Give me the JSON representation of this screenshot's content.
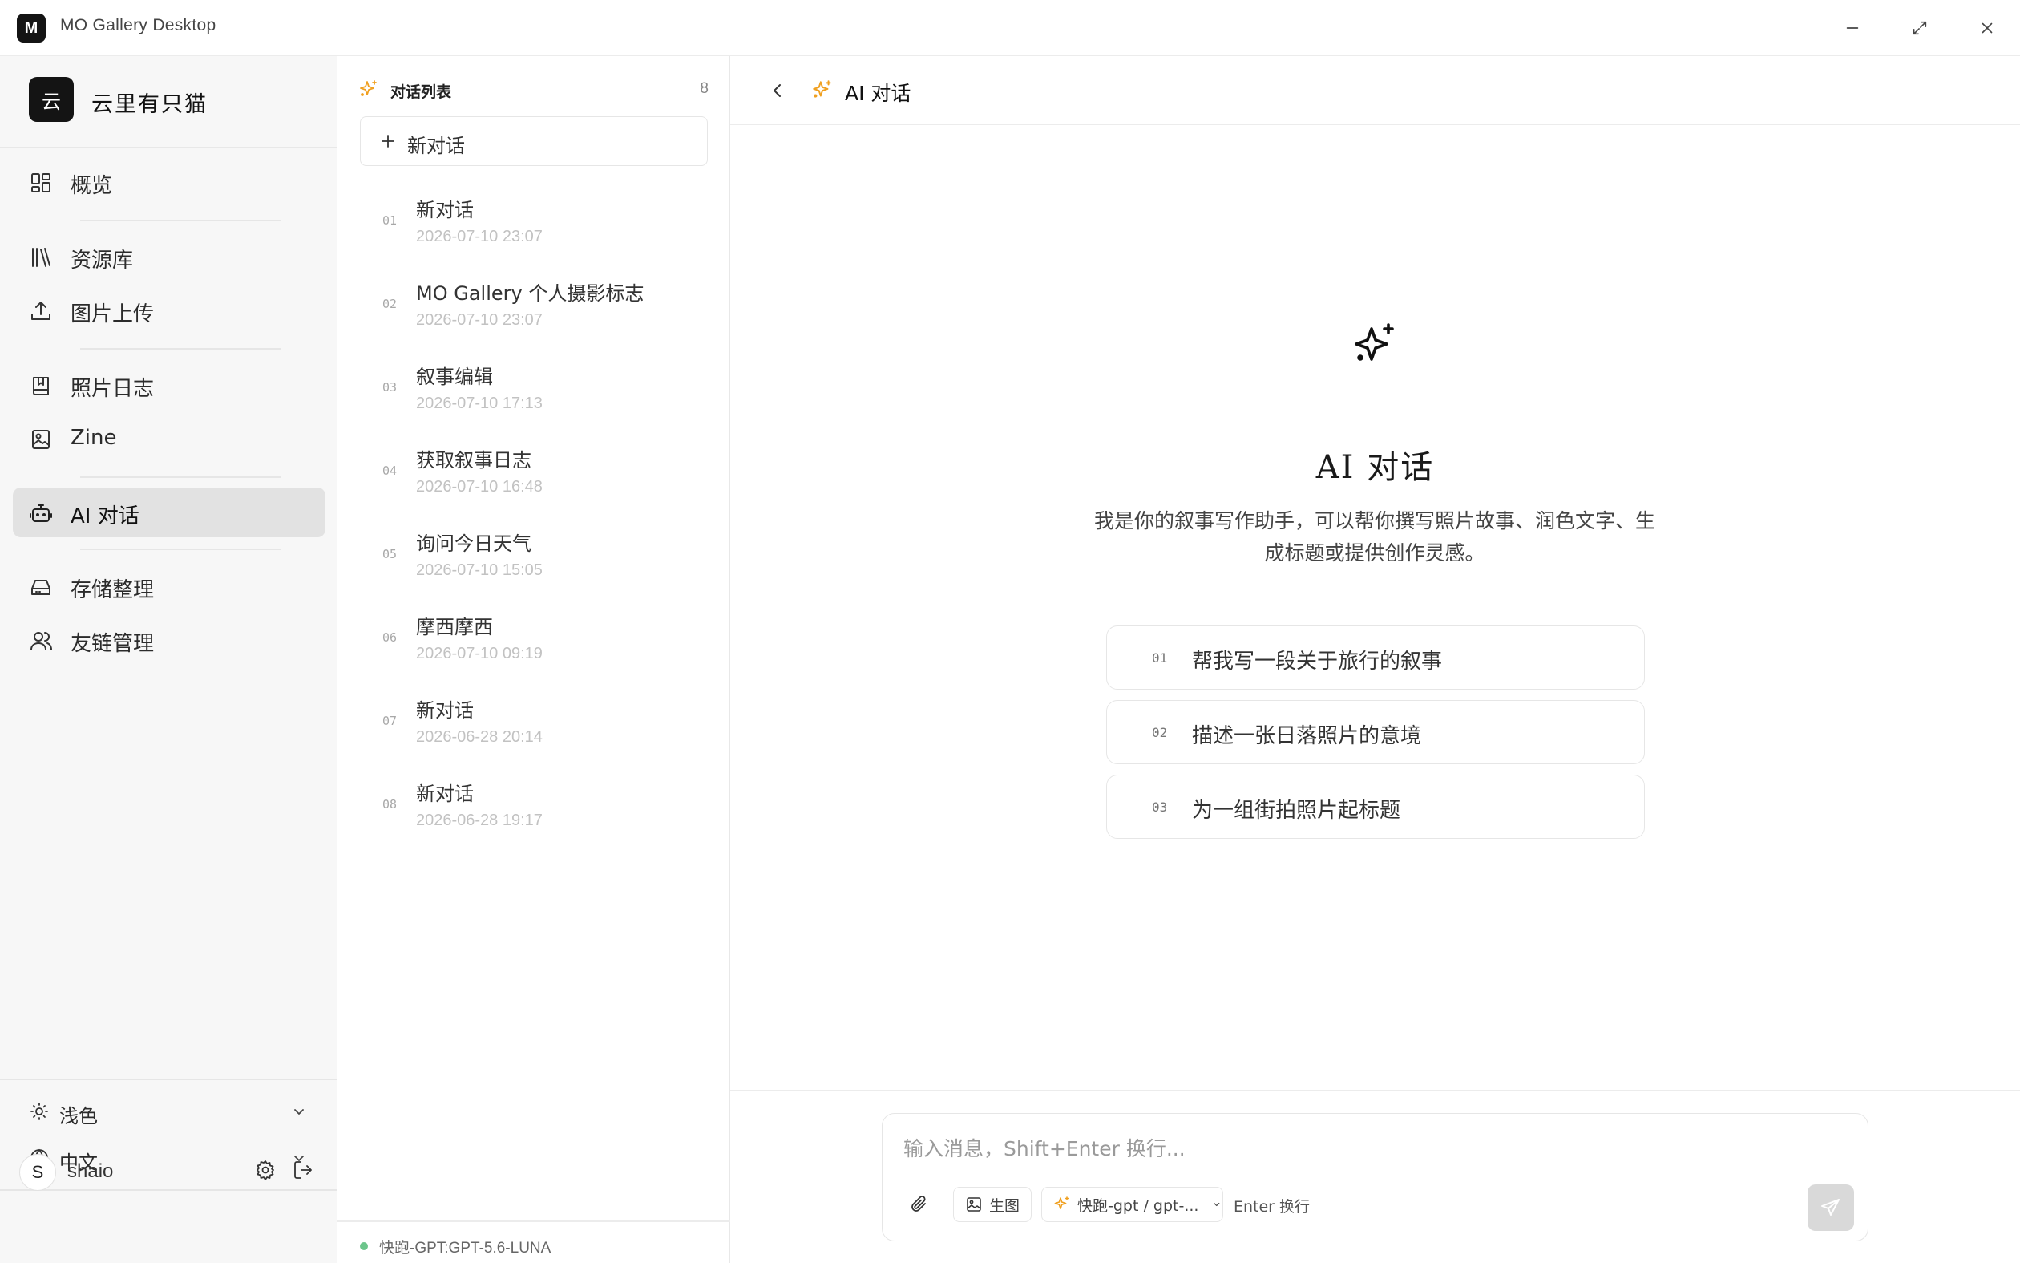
{
  "window": {
    "title": "MO Gallery Desktop",
    "logo_letter": "M"
  },
  "brand": {
    "avatar_char": "云",
    "name": "云里有只猫"
  },
  "nav": {
    "overview": "概览",
    "library": "资源库",
    "upload": "图片上传",
    "journal": "照片日志",
    "zine": "Zine",
    "ai_chat": "AI 对话",
    "storage": "存储整理",
    "friends": "友链管理"
  },
  "prefs": {
    "theme": "浅色",
    "language": "中文"
  },
  "user": {
    "initial": "S",
    "name": "shaio"
  },
  "conversations": {
    "header": "对话列表",
    "count": "8",
    "new_label": "新对话",
    "items": [
      {
        "num": "01",
        "title": "新对话",
        "time": "2026-07-10 23:07"
      },
      {
        "num": "02",
        "title": "MO Gallery 个人摄影标志",
        "time": "2026-07-10 23:07"
      },
      {
        "num": "03",
        "title": "叙事编辑",
        "time": "2026-07-10 17:13"
      },
      {
        "num": "04",
        "title": "获取叙事日志",
        "time": "2026-07-10 16:48"
      },
      {
        "num": "05",
        "title": "询问今日天气",
        "time": "2026-07-10 15:05"
      },
      {
        "num": "06",
        "title": "摩西摩西",
        "time": "2026-07-10 09:19"
      },
      {
        "num": "07",
        "title": "新对话",
        "time": "2026-06-28 20:14"
      },
      {
        "num": "08",
        "title": "新对话",
        "time": "2026-06-28 19:17"
      }
    ],
    "status": "快跑-GPT:GPT-5.6-LUNA"
  },
  "main": {
    "header_title": "AI 对话",
    "hero_title": "AI 对话",
    "hero_desc": "我是你的叙事写作助手，可以帮你撰写照片故事、润色文字、生成标题或提供创作灵感。",
    "suggestions": [
      {
        "num": "01",
        "text": "帮我写一段关于旅行的叙事"
      },
      {
        "num": "02",
        "text": "描述一张日落照片的意境"
      },
      {
        "num": "03",
        "text": "为一组街拍照片起标题"
      }
    ]
  },
  "composer": {
    "placeholder": "输入消息，Shift+Enter 换行...",
    "image_gen_label": "生图",
    "model_label": "快跑-gpt / gpt-...",
    "enter_hint": "Enter 换行"
  },
  "colors": {
    "accent": "#f0a020",
    "status_dot": "#6cc58b",
    "active_nav_bg": "#e2e2e2"
  },
  "icons": {
    "overview": "grid-icon",
    "library": "books-icon",
    "upload": "upload-icon",
    "journal": "bookmark-book-icon",
    "zine": "image-icon",
    "ai_chat": "robot-icon",
    "storage": "drive-icon",
    "friends": "users-icon",
    "theme": "sun-icon",
    "language": "globe-icon",
    "settings": "gear-icon",
    "logout": "logout-icon",
    "sparkle": "sparkle-icon",
    "attach": "paperclip-icon",
    "send": "send-icon"
  }
}
